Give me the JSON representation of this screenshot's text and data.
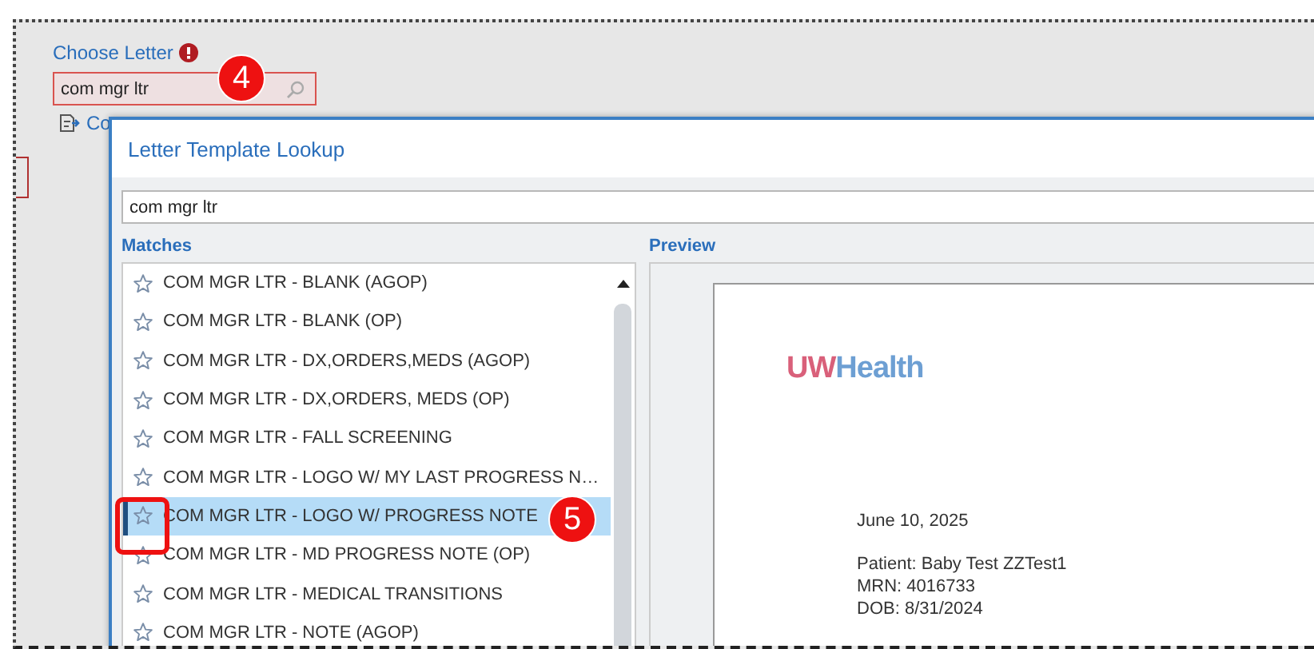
{
  "page": {
    "choose_label": "Choose Letter",
    "required": true,
    "search_value": "com mgr ltr",
    "link_label": "Co"
  },
  "dialog": {
    "title": "Letter Template Lookup",
    "search_value": "com mgr ltr",
    "matches_label": "Matches",
    "preview_label": "Preview",
    "matches": [
      {
        "label": "COM MGR LTR - BLANK (AGOP)",
        "selected": false
      },
      {
        "label": "COM MGR LTR - BLANK (OP)",
        "selected": false
      },
      {
        "label": "COM MGR LTR - DX,ORDERS,MEDS (AGOP)",
        "selected": false
      },
      {
        "label": "COM MGR LTR - DX,ORDERS, MEDS (OP)",
        "selected": false
      },
      {
        "label": "COM MGR LTR - FALL SCREENING",
        "selected": false
      },
      {
        "label": "COM MGR LTR - LOGO W/ MY LAST PROGRESS N…",
        "selected": false
      },
      {
        "label": "COM MGR LTR - LOGO W/ PROGRESS NOTE",
        "selected": true
      },
      {
        "label": "COM MGR LTR - MD PROGRESS NOTE (OP)",
        "selected": false
      },
      {
        "label": "COM MGR LTR - MEDICAL TRANSITIONS",
        "selected": false
      },
      {
        "label": "COM MGR LTR - NOTE (AGOP)",
        "selected": false
      }
    ],
    "preview": {
      "logo": [
        {
          "text": "UW",
          "color": "#d9607a"
        },
        {
          "text": "Health",
          "color": "#6d9fd3"
        }
      ],
      "date": "June 10, 2025",
      "lines": [
        "Patient: Baby Test ZZTest1",
        "MRN: 4016733",
        "DOB: 8/31/2024"
      ]
    }
  },
  "callouts": [
    {
      "number": "4"
    },
    {
      "number": "5"
    }
  ]
}
